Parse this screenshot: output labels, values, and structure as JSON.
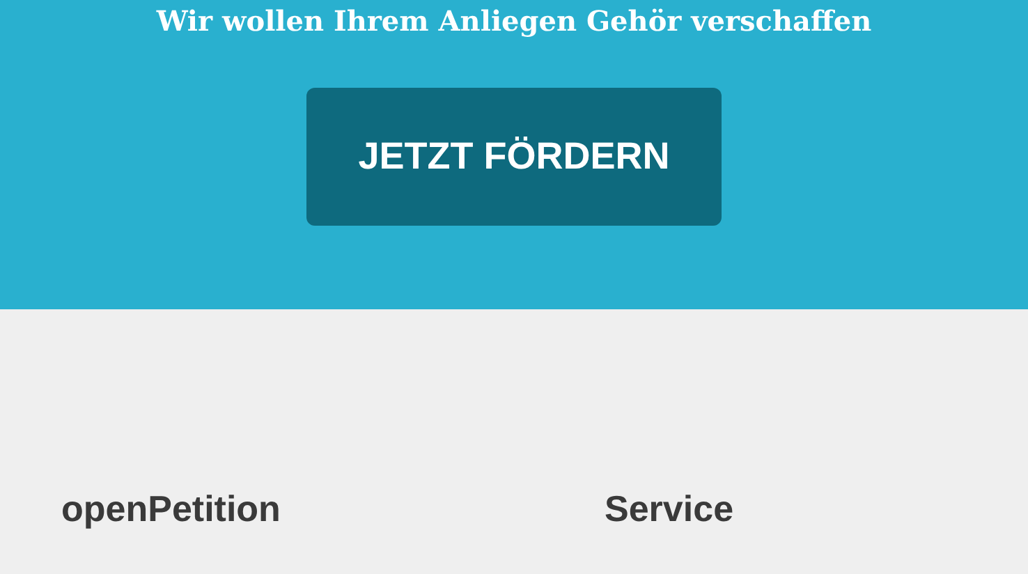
{
  "banner": {
    "heading": "Wir wollen Ihrem Anliegen Gehör verschaffen",
    "button": "JETZT FÖRDERN"
  },
  "footer": {
    "columns": [
      {
        "title": "openPetition"
      },
      {
        "title": "Service"
      }
    ]
  }
}
